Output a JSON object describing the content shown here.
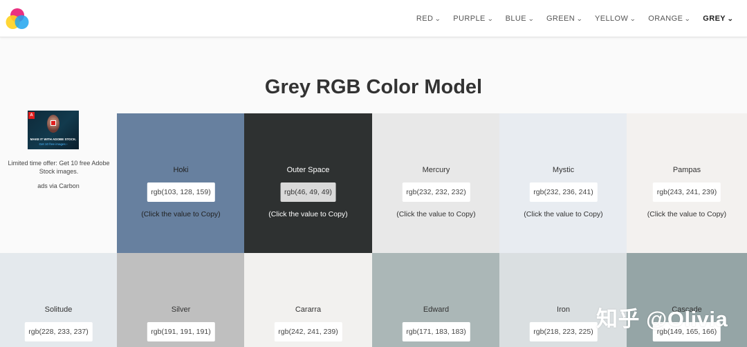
{
  "nav": {
    "items": [
      {
        "label": "RED",
        "active": false
      },
      {
        "label": "PURPLE",
        "active": false
      },
      {
        "label": "BLUE",
        "active": false
      },
      {
        "label": "GREEN",
        "active": false
      },
      {
        "label": "YELLOW",
        "active": false
      },
      {
        "label": "ORANGE",
        "active": false
      },
      {
        "label": "GREY",
        "active": true
      }
    ]
  },
  "page": {
    "title": "Grey RGB Color Model"
  },
  "ad": {
    "headline": "MAKE IT WITH ADOBE STOCK.",
    "cta": "Get 10 free images ›",
    "text": "Limited time offer: Get 10 free Adobe Stock images.",
    "via": "ads via Carbon"
  },
  "hint_label": "(Click the value to Copy)",
  "tiles": [
    {
      "name": "Hoki",
      "value": "rgb(103, 128, 159)",
      "bg": "#67809f",
      "fg": "#222222"
    },
    {
      "name": "Outer Space",
      "value": "rgb(46, 49, 49)",
      "bg": "#2e3131",
      "fg": "#ffffff"
    },
    {
      "name": "Mercury",
      "value": "rgb(232, 232, 232)",
      "bg": "#e8e8e8",
      "fg": "#333333"
    },
    {
      "name": "Mystic",
      "value": "rgb(232, 236, 241)",
      "bg": "#e8ecf1",
      "fg": "#333333"
    },
    {
      "name": "Pampas",
      "value": "rgb(243, 241, 239)",
      "bg": "#f3f1ef",
      "fg": "#333333"
    },
    {
      "name": "Solitude",
      "value": "rgb(228, 233, 237)",
      "bg": "#e4e9ed",
      "fg": "#333333"
    },
    {
      "name": "Silver",
      "value": "rgb(191, 191, 191)",
      "bg": "#bfbfbf",
      "fg": "#333333"
    },
    {
      "name": "Cararra",
      "value": "rgb(242, 241, 239)",
      "bg": "#f2f1ef",
      "fg": "#333333"
    },
    {
      "name": "Edward",
      "value": "rgb(171, 183, 183)",
      "bg": "#abb7b7",
      "fg": "#333333"
    },
    {
      "name": "Iron",
      "value": "rgb(218, 223, 225)",
      "bg": "#dadfe1",
      "fg": "#333333"
    },
    {
      "name": "Cascade",
      "value": "rgb(149, 165, 166)",
      "bg": "#95a5a6",
      "fg": "#333333"
    }
  ],
  "watermark": "知乎 @Olivia"
}
